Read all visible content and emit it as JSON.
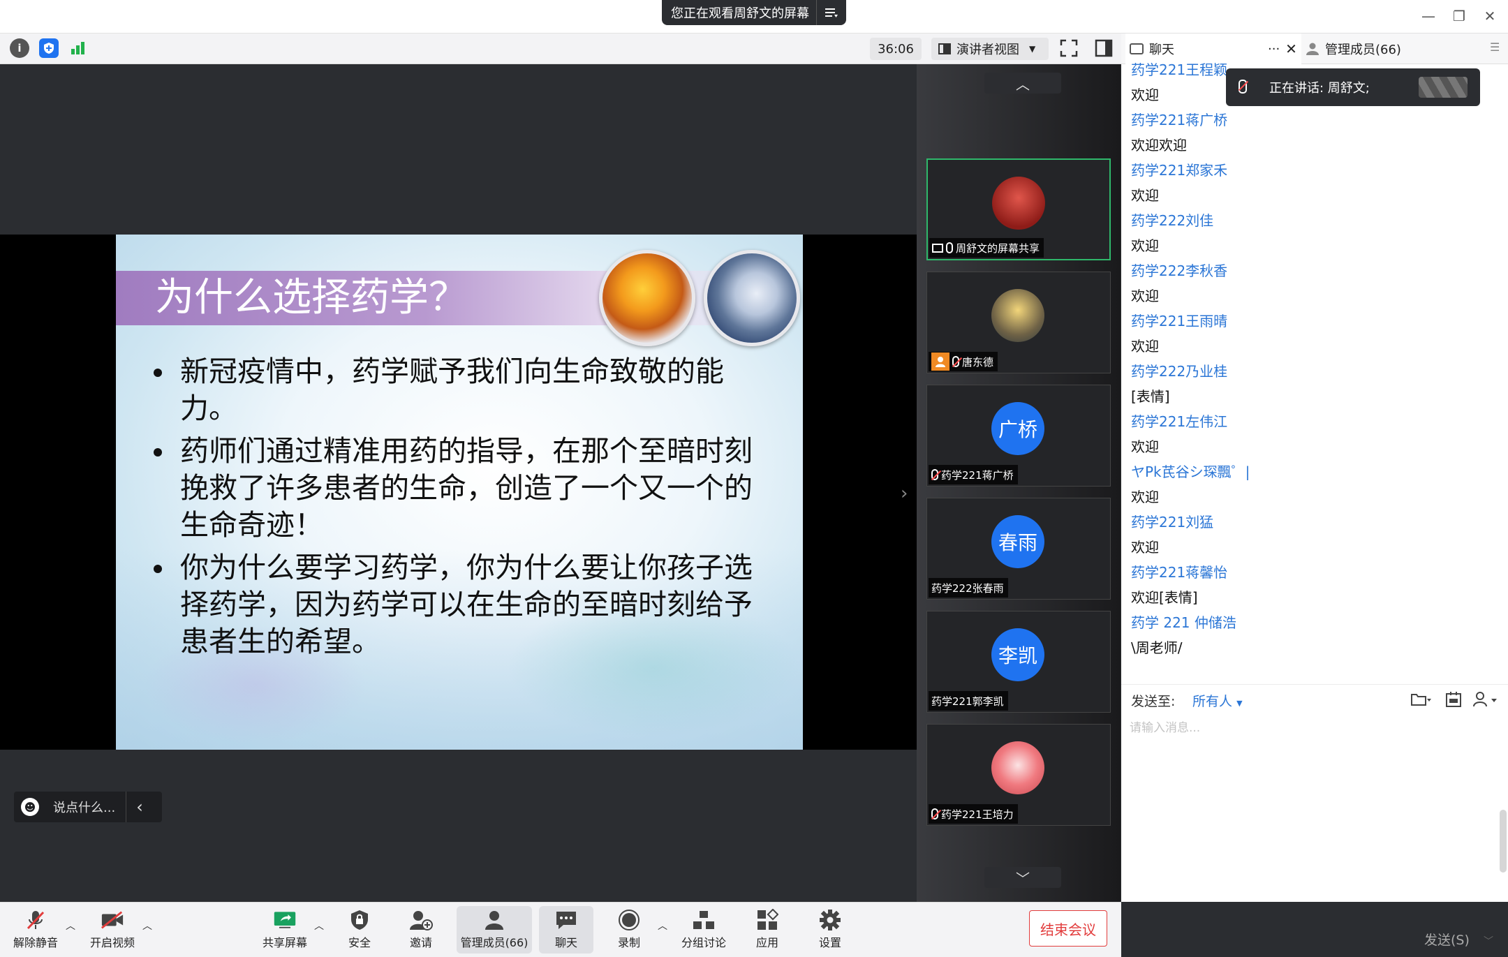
{
  "window": {
    "share_banner": "您正在观看周舒文的屏幕",
    "minimize": "—",
    "restore": "❐",
    "close": "✕"
  },
  "toolbar": {
    "timer": "36:06",
    "view_mode": "演讲者视图",
    "info_icon": "i"
  },
  "slide": {
    "title": "为什么选择药学？",
    "bullets": [
      "新冠疫情中，药学赋予我们向生命致敬的能力。",
      "药师们通过精准用药的指导，在那个至暗时刻挽救了许多患者的生命，创造了一个又一个的生命奇迹！",
      "你为什么要学习药学，你为什么要让你孩子选择药学，因为药学可以在生命的至暗时刻给予患者生的希望。"
    ]
  },
  "reaction": {
    "placeholder": "说点什么..."
  },
  "participants": [
    {
      "name": "周舒文的屏幕共享",
      "avatar_text": "",
      "avatar_color": "#b8322c",
      "active": true,
      "mic": "on",
      "share": true
    },
    {
      "name": "唐东德",
      "avatar_text": "",
      "avatar_color": "#7a6a4e",
      "active": false,
      "mic": "muted",
      "share": false
    },
    {
      "name": "药学221蒋广桥",
      "avatar_text": "广桥",
      "avatar_color": "#1f73f0",
      "active": false,
      "mic": "muted",
      "share": false
    },
    {
      "name": "药学222张春雨",
      "avatar_text": "春雨",
      "avatar_color": "#1f73f0",
      "active": false,
      "mic": "none",
      "share": false
    },
    {
      "name": "药学221郭李凯",
      "avatar_text": "李凯",
      "avatar_color": "#1f73f0",
      "active": false,
      "mic": "none",
      "share": false
    },
    {
      "name": "药学221王培力",
      "avatar_text": "",
      "avatar_color": "#f07a80",
      "active": false,
      "mic": "muted",
      "share": false
    }
  ],
  "chat": {
    "tab_label": "聊天",
    "members_label": "管理成员(66)",
    "speaking": "正在讲话: 周舒文;",
    "messages": [
      {
        "name": "药学221王程颖",
        "text": "欢迎"
      },
      {
        "name": "药学221蒋广桥",
        "text": "欢迎欢迎"
      },
      {
        "name": "药学221郑家禾",
        "text": "欢迎"
      },
      {
        "name": "药学222刘佳",
        "text": "欢迎"
      },
      {
        "name": "药学222李秋香",
        "text": "欢迎"
      },
      {
        "name": "药学221王雨晴",
        "text": "欢迎"
      },
      {
        "name": "药学222乃业桂",
        "text": "[表情]"
      },
      {
        "name": "药学221左伟江",
        "text": "欢迎"
      },
      {
        "name": "ヤPk芪谷シ琛飄゜|",
        "text": "欢迎"
      },
      {
        "name": "药学221刘猛",
        "text": "欢迎"
      },
      {
        "name": "药学221蒋馨怡",
        "text": "欢迎[表情]"
      },
      {
        "name": "药学 221 仲储浩",
        "text": "\\周老师/"
      }
    ],
    "send_to_label": "发送至:",
    "send_to_value": "所有人",
    "input_placeholder": "请输入消息...",
    "send_button": "发送(S)"
  },
  "bottombar": {
    "unmute": "解除静音",
    "start_video": "开启视频",
    "share_screen": "共享屏幕",
    "security": "安全",
    "invite": "邀请",
    "manage_members": "管理成员(66)",
    "chat": "聊天",
    "record": "录制",
    "breakout": "分组讨论",
    "apps": "应用",
    "settings": "设置",
    "end_meeting": "结束会议"
  },
  "colors": {
    "accent_blue": "#1f73f0",
    "chat_name": "#2b76d6",
    "end_red": "#e23c3c",
    "active_green": "#2fb86b"
  }
}
